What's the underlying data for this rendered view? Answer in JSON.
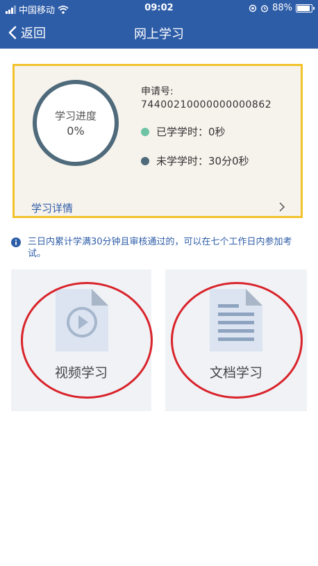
{
  "status_bar": {
    "carrier": "中国移动",
    "time": "09:02",
    "battery": "88%",
    "battery_level": 0.88
  },
  "nav": {
    "back_label": "返回",
    "title": "网上学习"
  },
  "progress_card": {
    "progress_label": "学习进度",
    "progress_value": "0%",
    "application_label": "申请号:",
    "application_number": "74400210000000000862",
    "studied_label": "已学学时：0秒",
    "remaining_label": "未学学时：30分0秒",
    "detail_link": "学习详情"
  },
  "notice": "三日内累计学满30分钟且审核通过的，可以在七个工作日内参加考试。",
  "tiles": {
    "video_label": "视频学习",
    "doc_label": "文档学习"
  },
  "colors": {
    "brand": "#2e5da8",
    "card_border": "#f3c22b",
    "ring": "#4e6a7b",
    "studied_dot": "#6cc4a4",
    "annotation": "#d9232a"
  }
}
